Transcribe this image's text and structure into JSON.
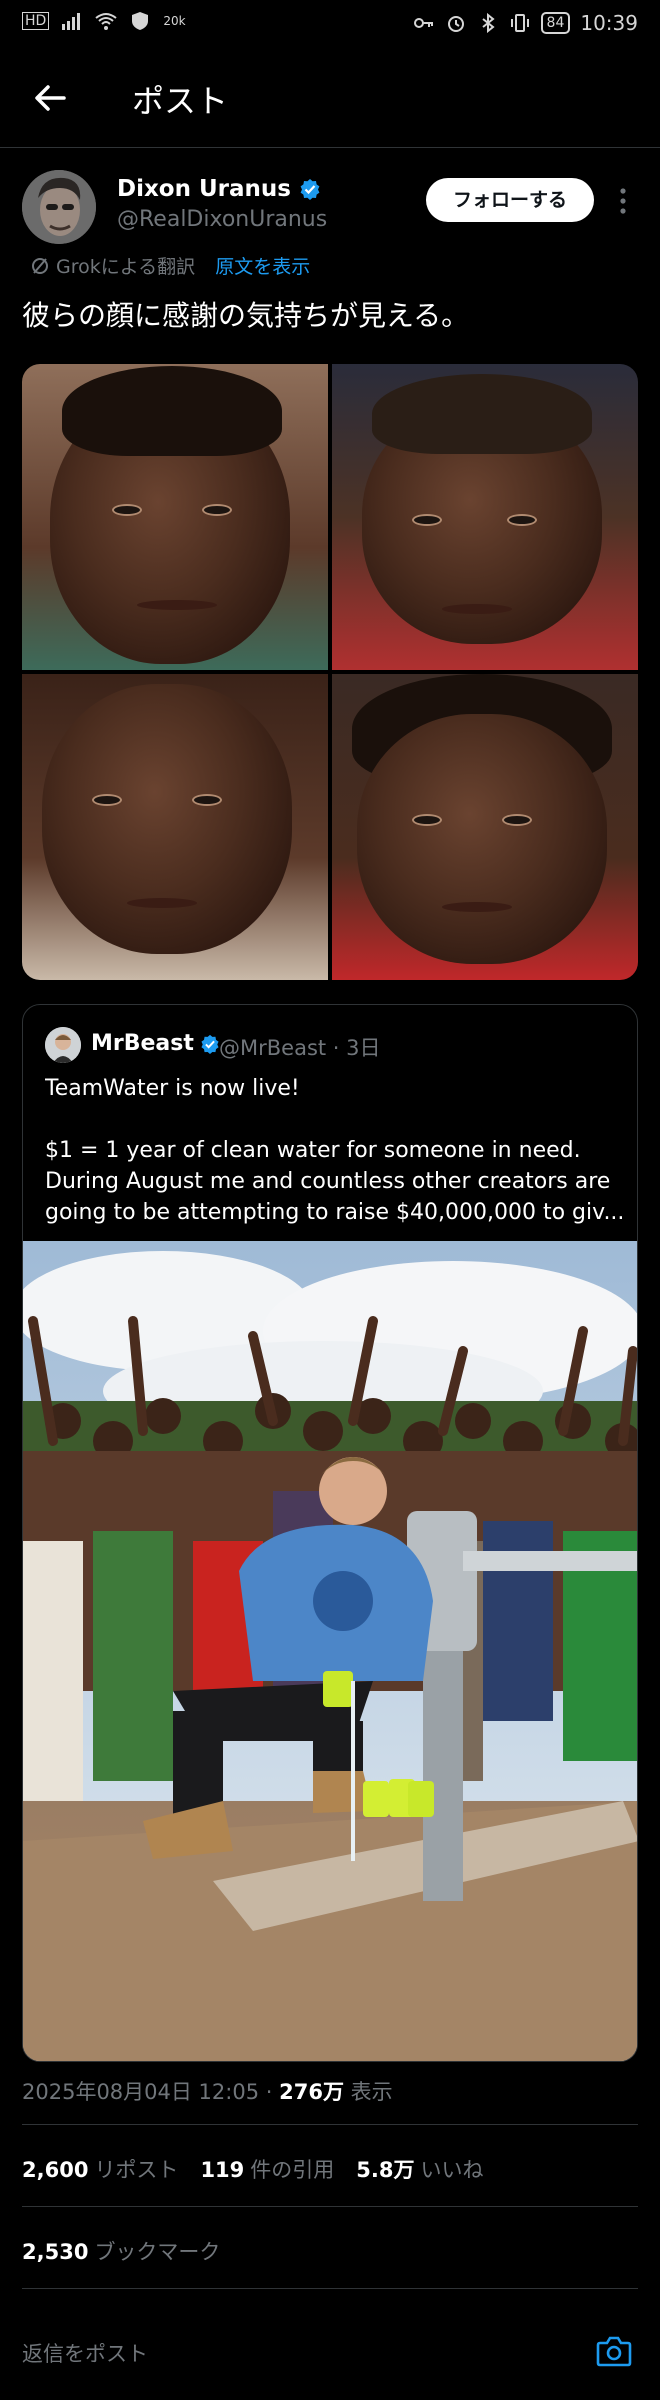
{
  "status_bar": {
    "left": [
      "HD",
      "20k"
    ],
    "battery": "84",
    "time": "10:39"
  },
  "header": {
    "title": "ポスト"
  },
  "author": {
    "name": "Dixon Uranus",
    "handle": "@RealDixonUranus",
    "follow_label": "フォローする"
  },
  "translation": {
    "label": "Grokによる翻訳",
    "show_original": "原文を表示"
  },
  "post": {
    "text": "彼らの顔に感謝の気持ちが見える。"
  },
  "quote": {
    "name": "MrBeast",
    "handle_time": "@MrBeast · 3日",
    "lines": [
      "TeamWater is now live!",
      "",
      "$1 = 1 year of clean water for someone in need.",
      "During August me and countless other creators are",
      "going to be attempting to raise $40,000,000 to giv..."
    ]
  },
  "meta": {
    "datetime": "2025年08月04日 12:05 · ",
    "views_count": "276万",
    "views_label": " 表示"
  },
  "stats": {
    "reposts_count": "2,600",
    "reposts_label": "リポスト",
    "quotes_count": "119",
    "quotes_label": "件の引用",
    "likes_count": "5.8万",
    "likes_label": "いいね",
    "bookmarks_count": "2,530",
    "bookmarks_label": "ブックマーク"
  },
  "reply": {
    "placeholder": "返信をポスト"
  },
  "colors": {
    "accent": "#1d9bf0",
    "verified": "#1d9bf0",
    "background": "#000000",
    "muted": "#71767b"
  }
}
